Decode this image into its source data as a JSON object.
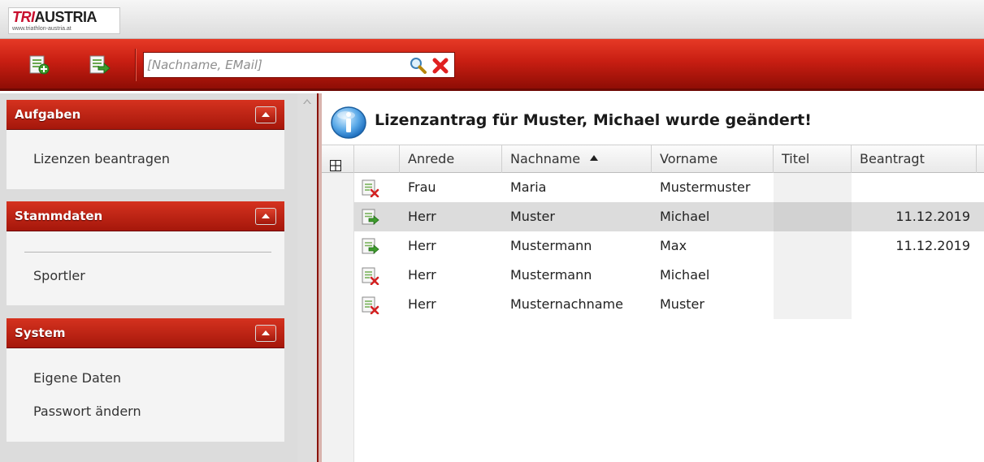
{
  "brand": {
    "logo_part1": "TRI",
    "logo_part2": "AUSTRIA",
    "logo_url": "www.triathlon-austria.at"
  },
  "toolbar": {
    "buttons": [
      {
        "icon": "add-document-icon"
      },
      {
        "icon": "export-document-icon"
      }
    ],
    "search": {
      "value": "",
      "placeholder": "[Nachname, EMail]",
      "search_icon": "search-icon",
      "clear_icon": "clear-icon"
    }
  },
  "sidebar": {
    "panels": [
      {
        "title": "Aufgaben",
        "items": [
          "Lizenzen beantragen"
        ]
      },
      {
        "title": "Stammdaten",
        "items": [
          "Sportler"
        ]
      },
      {
        "title": "System",
        "items": [
          "Eigene Daten",
          "Passwort ändern"
        ]
      }
    ]
  },
  "main": {
    "message": "Lizenzantrag für Muster, Michael wurde geändert!",
    "message_icon": "info-icon",
    "grid": {
      "columns": [
        "Anrede",
        "Nachname",
        "Vorname",
        "Titel",
        "Beantragt"
      ],
      "sorted_column": "Nachname",
      "sort_direction": "ascending",
      "rows": [
        {
          "status_icon": "not-submitted-icon",
          "anrede": "Frau",
          "nachname": "Maria",
          "vorname": "Mustermuster",
          "titel": "",
          "beantragt": ""
        },
        {
          "status_icon": "submitted-icon",
          "anrede": "Herr",
          "nachname": "Muster",
          "vorname": "Michael",
          "titel": "",
          "beantragt": "11.12.2019",
          "selected": true
        },
        {
          "status_icon": "submitted-icon",
          "anrede": "Herr",
          "nachname": "Mustermann",
          "vorname": "Max",
          "titel": "",
          "beantragt": "11.12.2019"
        },
        {
          "status_icon": "not-submitted-icon",
          "anrede": "Herr",
          "nachname": "Mustermann",
          "vorname": "Michael",
          "titel": "",
          "beantragt": ""
        },
        {
          "status_icon": "not-submitted-icon",
          "anrede": "Herr",
          "nachname": "Musternachname",
          "vorname": "Muster",
          "titel": "",
          "beantragt": ""
        }
      ]
    }
  },
  "colors": {
    "brand_red": "#c81e12",
    "dark_red": "#8f0d05",
    "selected_row": "#dcdcdc"
  }
}
